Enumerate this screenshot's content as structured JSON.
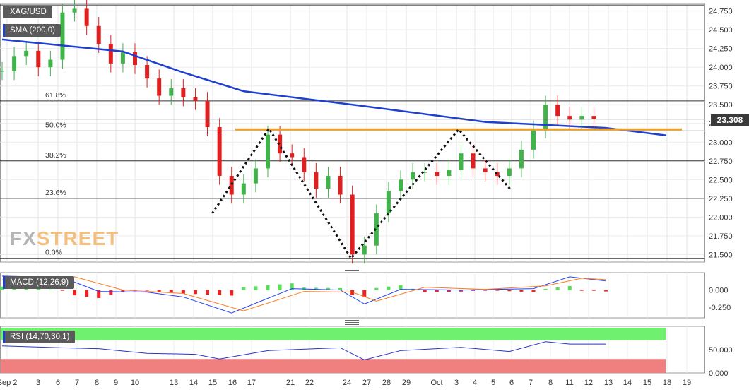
{
  "symbol": "XAG/USD",
  "sma_label": "SMA (200,0)",
  "macd_label": "MACD (12,26,9)",
  "rsi_label": "RSI (14,70,30,1)",
  "watermark": {
    "fx": "FX",
    "street": "STREET"
  },
  "last_price_label": "23.308",
  "colors": {
    "up_candle": "#41b34b",
    "down_candle": "#e02020",
    "sma": "#1f3fd0",
    "resistance": "#f0a020",
    "pattern": "#111111",
    "macd_line": "#2040ff",
    "signal_line": "#ff7a1a",
    "hist_pos": "#55e055",
    "hist_neg": "#ee2222",
    "rsi_line": "#2a34c8",
    "rsi_overbought_zone": "#6ff06f",
    "rsi_oversold_zone": "#f08080"
  },
  "chart_data": [
    {
      "type": "candlestick",
      "ylim": [
        21.4,
        24.85
      ],
      "y_ticks": [
        "24.750",
        "24.500",
        "24.250",
        "24.000",
        "23.750",
        "23.500",
        "23.250",
        "23.000",
        "22.750",
        "22.500",
        "22.250",
        "22.000",
        "21.750",
        "21.500"
      ],
      "x_ticks": [
        "Sep 2",
        "3",
        "6",
        "7",
        "8",
        "9",
        "10",
        "13",
        "14",
        "15",
        "16",
        "17",
        "21",
        "22",
        "24",
        "27",
        "28",
        "29",
        "Oct",
        "3",
        "4",
        "5",
        "6",
        "7",
        "8",
        "11",
        "12",
        "13",
        "14",
        "15",
        "18",
        "19"
      ],
      "fibonacci": [
        {
          "label": "61.8%",
          "value": 23.55
        },
        {
          "label": "50.0%",
          "value": 23.15
        },
        {
          "label": "38.2%",
          "value": 22.75
        },
        {
          "label": "23.6%",
          "value": 22.25
        },
        {
          "label": "0.0%",
          "value": 21.45
        }
      ],
      "top_reference": 24.83,
      "resistance": 23.17,
      "double_top_pattern": [
        [
          17.4,
          22.05
        ],
        [
          22.1,
          23.18
        ],
        [
          28.9,
          21.45
        ],
        [
          37.8,
          23.17
        ],
        [
          42.2,
          22.35
        ]
      ],
      "sma200_series": [
        [
          0,
          24.37
        ],
        [
          10,
          24.21
        ],
        [
          15,
          23.93
        ],
        [
          20,
          23.68
        ],
        [
          30,
          23.48
        ],
        [
          40,
          23.27
        ],
        [
          50,
          23.19
        ],
        [
          55,
          23.09
        ]
      ],
      "candles_series": [
        [
          0,
          23.95
        ],
        [
          1,
          24.15
        ],
        [
          2,
          24.22
        ],
        [
          3,
          24.0
        ],
        [
          4,
          24.1
        ],
        [
          5,
          24.73
        ],
        [
          6,
          24.78
        ],
        [
          7,
          24.55
        ],
        [
          8,
          24.31
        ],
        [
          9,
          24.05
        ],
        [
          10,
          24.2
        ],
        [
          11,
          24.03
        ],
        [
          12,
          23.85
        ],
        [
          13,
          23.62
        ],
        [
          14,
          23.72
        ],
        [
          15,
          23.6
        ],
        [
          16,
          23.55
        ],
        [
          17,
          23.2
        ],
        [
          18,
          22.55
        ],
        [
          19,
          22.3
        ],
        [
          20,
          22.45
        ],
        [
          21,
          22.65
        ],
        [
          22,
          23.1
        ],
        [
          23,
          22.85
        ],
        [
          24,
          22.8
        ],
        [
          25,
          22.6
        ],
        [
          26,
          22.38
        ],
        [
          27,
          22.55
        ],
        [
          28,
          22.3
        ],
        [
          29,
          21.5
        ],
        [
          30,
          21.62
        ],
        [
          31,
          22.05
        ],
        [
          32,
          22.35
        ],
        [
          33,
          22.5
        ],
        [
          34,
          22.6
        ],
        [
          35,
          22.6
        ],
        [
          36,
          22.55
        ],
        [
          37,
          22.63
        ],
        [
          38,
          22.85
        ],
        [
          39,
          22.65
        ],
        [
          40,
          22.6
        ],
        [
          41,
          22.55
        ],
        [
          42,
          22.65
        ],
        [
          43,
          22.9
        ],
        [
          44,
          23.17
        ],
        [
          45,
          23.5
        ],
        [
          46,
          23.35
        ],
        [
          47,
          23.3
        ],
        [
          48,
          23.35
        ],
        [
          49,
          23.31
        ]
      ],
      "last_price": 23.308
    },
    {
      "type": "line",
      "name": "MACD (12,26,9)",
      "ylim": [
        -0.4,
        0.25
      ],
      "y_ticks": [
        "0.000",
        "-0.250"
      ],
      "macd_series": [
        [
          0,
          0.2
        ],
        [
          5,
          0.18
        ],
        [
          8,
          -0.02
        ],
        [
          12,
          -0.03
        ],
        [
          15,
          -0.1
        ],
        [
          19,
          -0.33
        ],
        [
          24,
          0.02
        ],
        [
          28,
          0.0
        ],
        [
          30,
          -0.2
        ],
        [
          33,
          0.01
        ],
        [
          38,
          0.0
        ],
        [
          44,
          0.02
        ],
        [
          47,
          0.19
        ],
        [
          50,
          0.13
        ]
      ],
      "signal_series": [
        [
          0,
          0.15
        ],
        [
          6,
          0.19
        ],
        [
          10,
          0.0
        ],
        [
          15,
          -0.05
        ],
        [
          20,
          -0.3
        ],
        [
          25,
          -0.02
        ],
        [
          29,
          -0.03
        ],
        [
          31,
          -0.16
        ],
        [
          35,
          0.04
        ],
        [
          40,
          0.01
        ],
        [
          45,
          0.06
        ],
        [
          48,
          0.17
        ],
        [
          50,
          0.15
        ]
      ]
    },
    {
      "type": "line",
      "name": "RSI (14,70,30,1)",
      "ylim": [
        0,
        100
      ],
      "y_ticks": [
        "50.000",
        "0.000"
      ],
      "overbought": 70,
      "oversold": 30,
      "rsi_series": [
        [
          0,
          58
        ],
        [
          5,
          54
        ],
        [
          8,
          52
        ],
        [
          12,
          42
        ],
        [
          16,
          40
        ],
        [
          18,
          30
        ],
        [
          22,
          48
        ],
        [
          26,
          52
        ],
        [
          28,
          54
        ],
        [
          30,
          28
        ],
        [
          33,
          48
        ],
        [
          38,
          55
        ],
        [
          42,
          46
        ],
        [
          45,
          67
        ],
        [
          47,
          62
        ],
        [
          50,
          62
        ]
      ]
    }
  ]
}
